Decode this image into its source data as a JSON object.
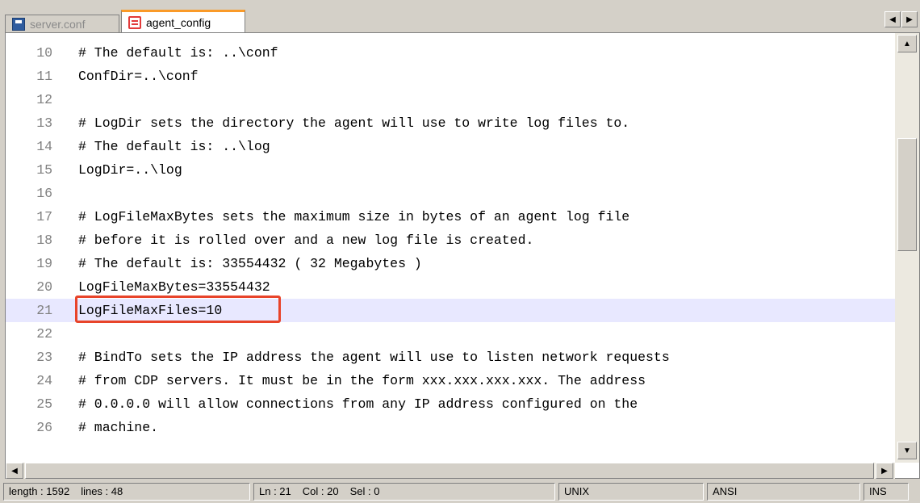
{
  "tabs": [
    {
      "label": "server.conf",
      "icon": "floppy-disk-icon",
      "active": false
    },
    {
      "label": "agent_config",
      "icon": "unsaved-file-icon",
      "active": true
    }
  ],
  "editor": {
    "current_line": 21,
    "highlighted_text": "LogFileMaxFiles=10",
    "lines": [
      {
        "number": "10",
        "text": "# The default is: ..\\conf"
      },
      {
        "number": "11",
        "text": "ConfDir=..\\conf"
      },
      {
        "number": "12",
        "text": ""
      },
      {
        "number": "13",
        "text": "# LogDir sets the directory the agent will use to write log files to."
      },
      {
        "number": "14",
        "text": "# The default is: ..\\log"
      },
      {
        "number": "15",
        "text": "LogDir=..\\log"
      },
      {
        "number": "16",
        "text": ""
      },
      {
        "number": "17",
        "text": "# LogFileMaxBytes sets the maximum size in bytes of an agent log file"
      },
      {
        "number": "18",
        "text": "# before it is rolled over and a new log file is created."
      },
      {
        "number": "19",
        "text": "# The default is: 33554432 ( 32 Megabytes )"
      },
      {
        "number": "20",
        "text": "LogFileMaxBytes=33554432"
      },
      {
        "number": "21",
        "text": "LogFileMaxFiles=10"
      },
      {
        "number": "22",
        "text": ""
      },
      {
        "number": "23",
        "text": "# BindTo sets the IP address the agent will use to listen network requests"
      },
      {
        "number": "24",
        "text": "# from CDP servers. It must be in the form xxx.xxx.xxx.xxx. The address"
      },
      {
        "number": "25",
        "text": "# 0.0.0.0 will allow connections from any IP address configured on the"
      },
      {
        "number": "26",
        "text": "# machine."
      }
    ]
  },
  "statusbar": {
    "length": "length : 1592",
    "lines": "lines : 48",
    "ln": "Ln : 21",
    "col": "Col : 20",
    "sel": "Sel : 0",
    "eol": "UNIX",
    "encoding": "ANSI",
    "mode": "INS"
  },
  "colors": {
    "active_tab_accent": "#fa9a28",
    "current_line_bg": "#e8e8ff",
    "highlight_border": "#e8442a"
  }
}
